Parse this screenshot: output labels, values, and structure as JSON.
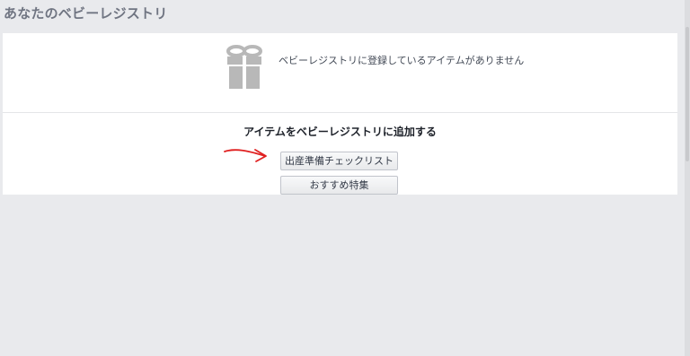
{
  "page": {
    "title": "あなたのベビーレジストリ"
  },
  "registry": {
    "empty_message": "ベビーレジストリに登録しているアイテムがありません",
    "empty_icon": "gift-icon",
    "add_heading": "アイテムをベビーレジストリに追加する",
    "buttons": {
      "checklist_label": "出産準備チェックリスト",
      "featured_label": "おすすめ特集"
    }
  },
  "annotation": {
    "arrow_color": "#e02020"
  },
  "colors": {
    "background": "#e9eaed",
    "panel": "#ffffff",
    "icon": "#b8b8b8"
  }
}
